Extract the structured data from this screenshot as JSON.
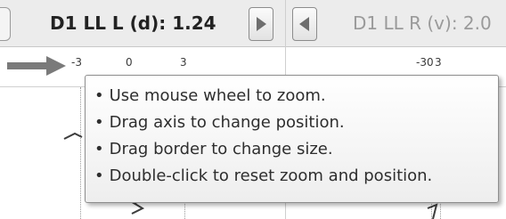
{
  "header": {
    "left_channel_title": "D1 LL L (d): 1.24",
    "right_channel_title": "D1 LL R (v): 2.0",
    "next_icon": "triangle-right-icon",
    "prev_icon": "triangle-left-icon"
  },
  "axis": {
    "left_ticks": [
      "-3",
      "0",
      "3"
    ],
    "right_ticks": [
      "-30",
      "3"
    ],
    "scroll_arrow_icon": "arrow-right-icon"
  },
  "tooltip": {
    "bullet": "•",
    "lines": [
      "Use mouse wheel to zoom.",
      "Drag axis to change position.",
      "Drag border to change size.",
      "Double-click to reset zoom and position."
    ]
  },
  "colors": {
    "header_bg": "#ececec",
    "title_active": "#222222",
    "title_inactive": "#9a9a9a",
    "arrow": "#7a7a7a"
  }
}
